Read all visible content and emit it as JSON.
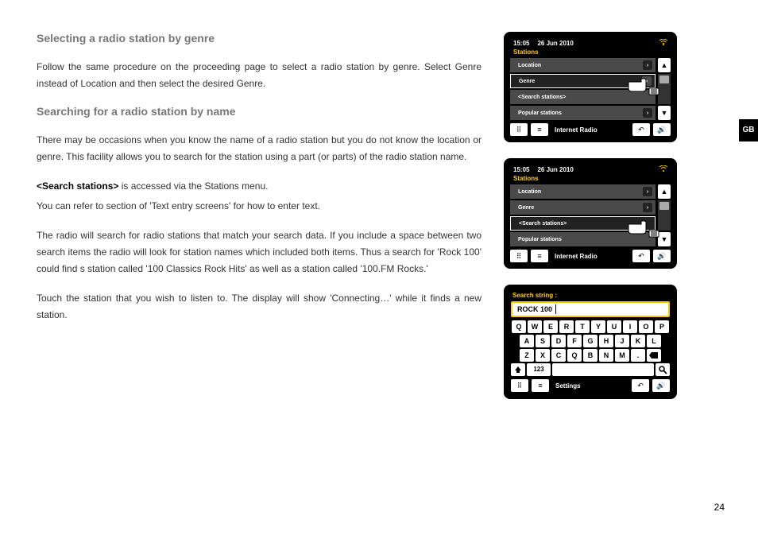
{
  "side_tab": "GB",
  "page_number": "24",
  "heading_genre": "Selecting a radio station by genre",
  "para_genre": "Follow the same procedure on the proceeding page to select a radio station by genre. Select Genre instead of Location and then select the desired Genre.",
  "heading_search": "Searching for a radio station by name",
  "para_search_1": "There may be occasions when you know the name of a radio station but you do not know the location or genre. This facility allows you to search for the station using a part (or parts) of the radio station name.",
  "para_search_2a": "<Search stations>",
  "para_search_2b": " is accessed via the Stations menu.",
  "para_search_3": "You can refer to section of 'Text entry screens' for how to enter text.",
  "para_search_4": "The radio will search for radio stations that match your search data. If you include a space between two search items the radio will look for station names which included both items. Thus a search for 'Rock 100' could find s station called '100 Classics Rock Hits' as well as a station called '100.FM Rocks.'",
  "para_search_5": "Touch the station that you wish to listen to. The display will show 'Connecting…' while it finds a new station.",
  "device": {
    "time": "15:05",
    "date": "26 Jun 2010",
    "title": "Stations",
    "items": [
      "Location",
      "Genre",
      "<Search stations>",
      "Popular stations"
    ],
    "foot": "Internet Radio",
    "foot2": "Settings"
  },
  "kbd": {
    "title": "Search string :",
    "value": "ROCK 100",
    "row1": [
      "Q",
      "W",
      "E",
      "R",
      "T",
      "Y",
      "U",
      "I",
      "O",
      "P"
    ],
    "row2": [
      "A",
      "S",
      "D",
      "F",
      "G",
      "H",
      "J",
      "K",
      "L"
    ],
    "row3": [
      "Z",
      "X",
      "C",
      "Q",
      "B",
      "N",
      "M",
      "."
    ],
    "num": "123"
  }
}
